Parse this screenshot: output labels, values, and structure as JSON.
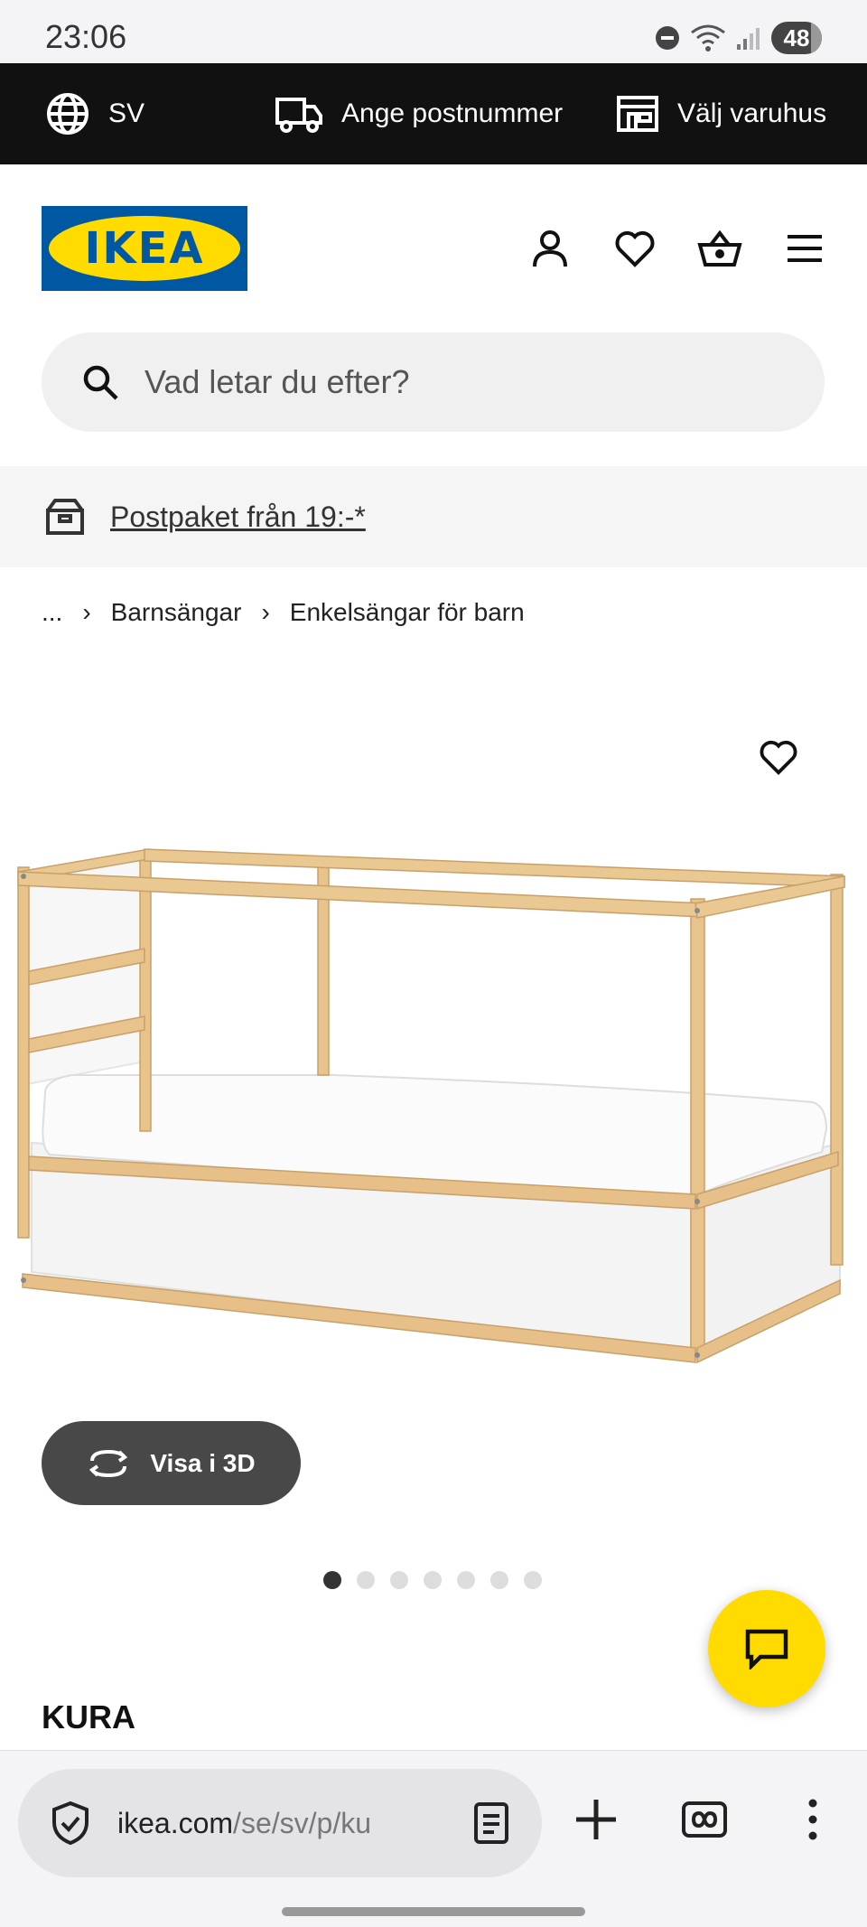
{
  "status_bar": {
    "time": "23:06",
    "battery": "48"
  },
  "top_strip": {
    "language": "SV",
    "postcode": "Ange postnummer",
    "store": "Välj varuhus"
  },
  "logo": {
    "text": "IKEA"
  },
  "search": {
    "placeholder": "Vad letar du efter?"
  },
  "promo": {
    "text": "Postpaket från 19:-*"
  },
  "breadcrumb": {
    "ellipsis": "...",
    "items": [
      "Barnsängar",
      "Enkelsängar för barn"
    ]
  },
  "product": {
    "view_3d_label": "Visa i 3D",
    "image_count": 7,
    "active_image": 1,
    "name": "KURA"
  },
  "browser": {
    "url_domain": "ikea.com",
    "url_path": "/se/sv/p/ku"
  },
  "colors": {
    "ikea_blue": "#0058a3",
    "ikea_yellow": "#ffdb00",
    "strip_bg": "#111111"
  }
}
